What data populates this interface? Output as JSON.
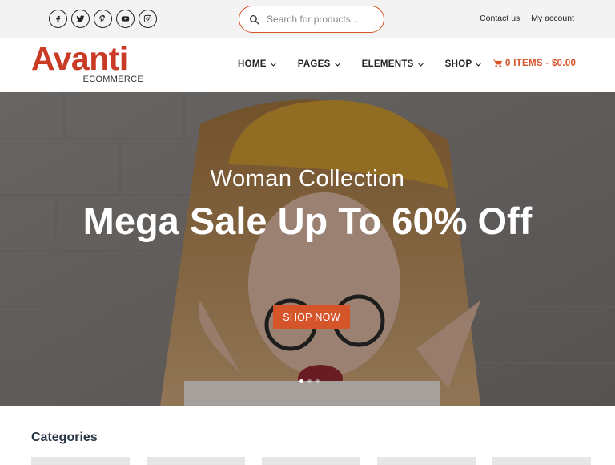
{
  "topbar": {
    "social_icons": [
      "facebook-icon",
      "twitter-icon",
      "pinterest-icon",
      "youtube-icon",
      "instagram-icon"
    ],
    "search_placeholder": "Search for products...",
    "contact_label": "Contact us",
    "account_label": "My account"
  },
  "header": {
    "logo_main": "Avanti",
    "logo_sub": "ECOMMERCE",
    "nav": [
      {
        "label": "HOME"
      },
      {
        "label": "PAGES"
      },
      {
        "label": "ELEMENTS"
      },
      {
        "label": "SHOP"
      }
    ],
    "cart_label": "0 ITEMS - $0.00"
  },
  "hero": {
    "subtitle": "Woman Collection",
    "title": "Mega Sale Up To 60% Off",
    "button_label": "SHOP NOW",
    "slide_count": 3,
    "active_slide": 1
  },
  "categories": {
    "title": "Categories",
    "card_count": 5
  },
  "colors": {
    "accent": "#d6542a",
    "logo": "#c93b25",
    "heading": "#263445",
    "topbar_bg": "#f3f3f3"
  }
}
